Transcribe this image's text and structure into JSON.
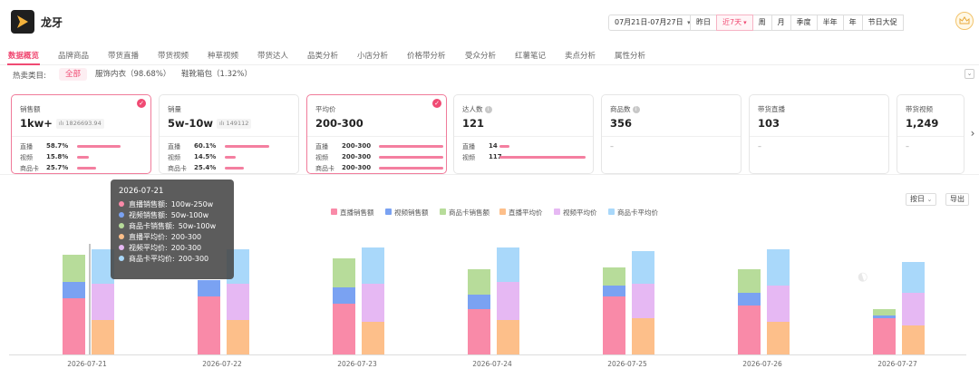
{
  "app": {
    "name": "龙牙"
  },
  "date_range": {
    "label": "07月21日-07月27日"
  },
  "periods": [
    "昨日",
    "近7天",
    "周",
    "月",
    "季度",
    "半年",
    "年",
    "节日大促"
  ],
  "active_period": "近7天",
  "tabs": [
    "数据概览",
    "品牌商品",
    "带货直播",
    "带货视频",
    "种草视频",
    "带货达人",
    "品类分析",
    "小店分析",
    "价格带分析",
    "受众分析",
    "红薯笔记",
    "卖点分析",
    "属性分析"
  ],
  "active_tab": "数据概览",
  "categories": {
    "label": "热卖类目:",
    "items": [
      "全部",
      "服饰内衣（98.68%）",
      "鞋靴箱包（1.32%）"
    ]
  },
  "cards": [
    {
      "label": "销售额",
      "value": "1kw+",
      "raw": "1826693.94",
      "selected": true,
      "breakdown": [
        {
          "name": "直播",
          "value": "58.7%",
          "fill": 0.587
        },
        {
          "name": "视频",
          "value": "15.8%",
          "fill": 0.158
        },
        {
          "name": "商品卡",
          "value": "25.7%",
          "fill": 0.257
        }
      ]
    },
    {
      "label": "销量",
      "value": "5w-10w",
      "raw": "149112",
      "selected": false,
      "breakdown": [
        {
          "name": "直播",
          "value": "60.1%",
          "fill": 0.601
        },
        {
          "name": "视频",
          "value": "14.5%",
          "fill": 0.145
        },
        {
          "name": "商品卡",
          "value": "25.4%",
          "fill": 0.254
        }
      ]
    },
    {
      "label": "平均价",
      "value": "200-300",
      "raw": "",
      "selected": true,
      "breakdown": [
        {
          "name": "直播",
          "value": "200-300",
          "fill": 0.85
        },
        {
          "name": "视频",
          "value": "200-300",
          "fill": 0.85
        },
        {
          "name": "商品卡",
          "value": "200-300",
          "fill": 0.85
        }
      ]
    },
    {
      "label": "达人数",
      "value": "121",
      "raw": "",
      "selected": false,
      "info": true,
      "breakdown": [
        {
          "name": "直播",
          "value": "14",
          "fill": 0.116
        },
        {
          "name": "视频",
          "value": "117",
          "fill": 0.967
        }
      ]
    },
    {
      "label": "商品数",
      "value": "356",
      "raw": "",
      "selected": false,
      "info": true,
      "empty": "–",
      "breakdown": []
    },
    {
      "label": "带货直播",
      "value": "103",
      "raw": "",
      "selected": false,
      "empty": "–",
      "breakdown": []
    },
    {
      "label": "带货视频",
      "value": "1,249",
      "raw": "",
      "selected": false,
      "empty": "–",
      "breakdown": []
    }
  ],
  "chart_controls": {
    "granularity": "按日",
    "export": "导出"
  },
  "colors": {
    "accent": "#f04a73",
    "live_sales": "#f98aa8",
    "video_sales": "#7aa2f2",
    "card_sales": "#b7dc9a",
    "live_avg": "#fdbf8a",
    "video_avg": "#e6b8f3",
    "card_avg": "#a9d8fa"
  },
  "chart_data": {
    "type": "bar",
    "categories": [
      "2026-07-21",
      "2026-07-22",
      "2026-07-23",
      "2026-07-24",
      "2026-07-25",
      "2026-07-26",
      "2026-07-27"
    ],
    "legend": [
      "直播销售额",
      "视频销售额",
      "商品卡销售额",
      "直播平均价",
      "视频平均价",
      "商品卡平均价"
    ],
    "legend_position": "top",
    "stacks": [
      {
        "stack": "销售额",
        "series": [
          {
            "name": "直播销售额",
            "values": [
              62,
              64,
              56,
              50,
              64,
              54,
              40
            ]
          },
          {
            "name": "视频销售额",
            "values": [
              18,
              18,
              18,
              16,
              12,
              14,
              3
            ]
          },
          {
            "name": "商品卡销售额",
            "values": [
              30,
              0,
              32,
              28,
              20,
              26,
              7
            ]
          }
        ]
      },
      {
        "stack": "平均价",
        "series": [
          {
            "name": "直播平均价",
            "values": [
              38,
              38,
              36,
              38,
              40,
              36,
              32
            ]
          },
          {
            "name": "视频平均价",
            "values": [
              40,
              40,
              42,
              42,
              38,
              40,
              36
            ]
          },
          {
            "name": "商品卡平均价",
            "values": [
              38,
              38,
              40,
              38,
              36,
              40,
              34
            ]
          }
        ]
      }
    ],
    "grid": false
  },
  "tooltip": {
    "date": "2026-07-21",
    "rows": [
      {
        "name": "直播销售额:",
        "value": "100w-250w"
      },
      {
        "name": "视频销售额:",
        "value": "50w-100w"
      },
      {
        "name": "商品卡销售额:",
        "value": "50w-100w"
      },
      {
        "name": "直播平均价:",
        "value": "200-300"
      },
      {
        "name": "视频平均价:",
        "value": "200-300"
      },
      {
        "name": "商品卡平均价:",
        "value": "200-300"
      }
    ]
  }
}
